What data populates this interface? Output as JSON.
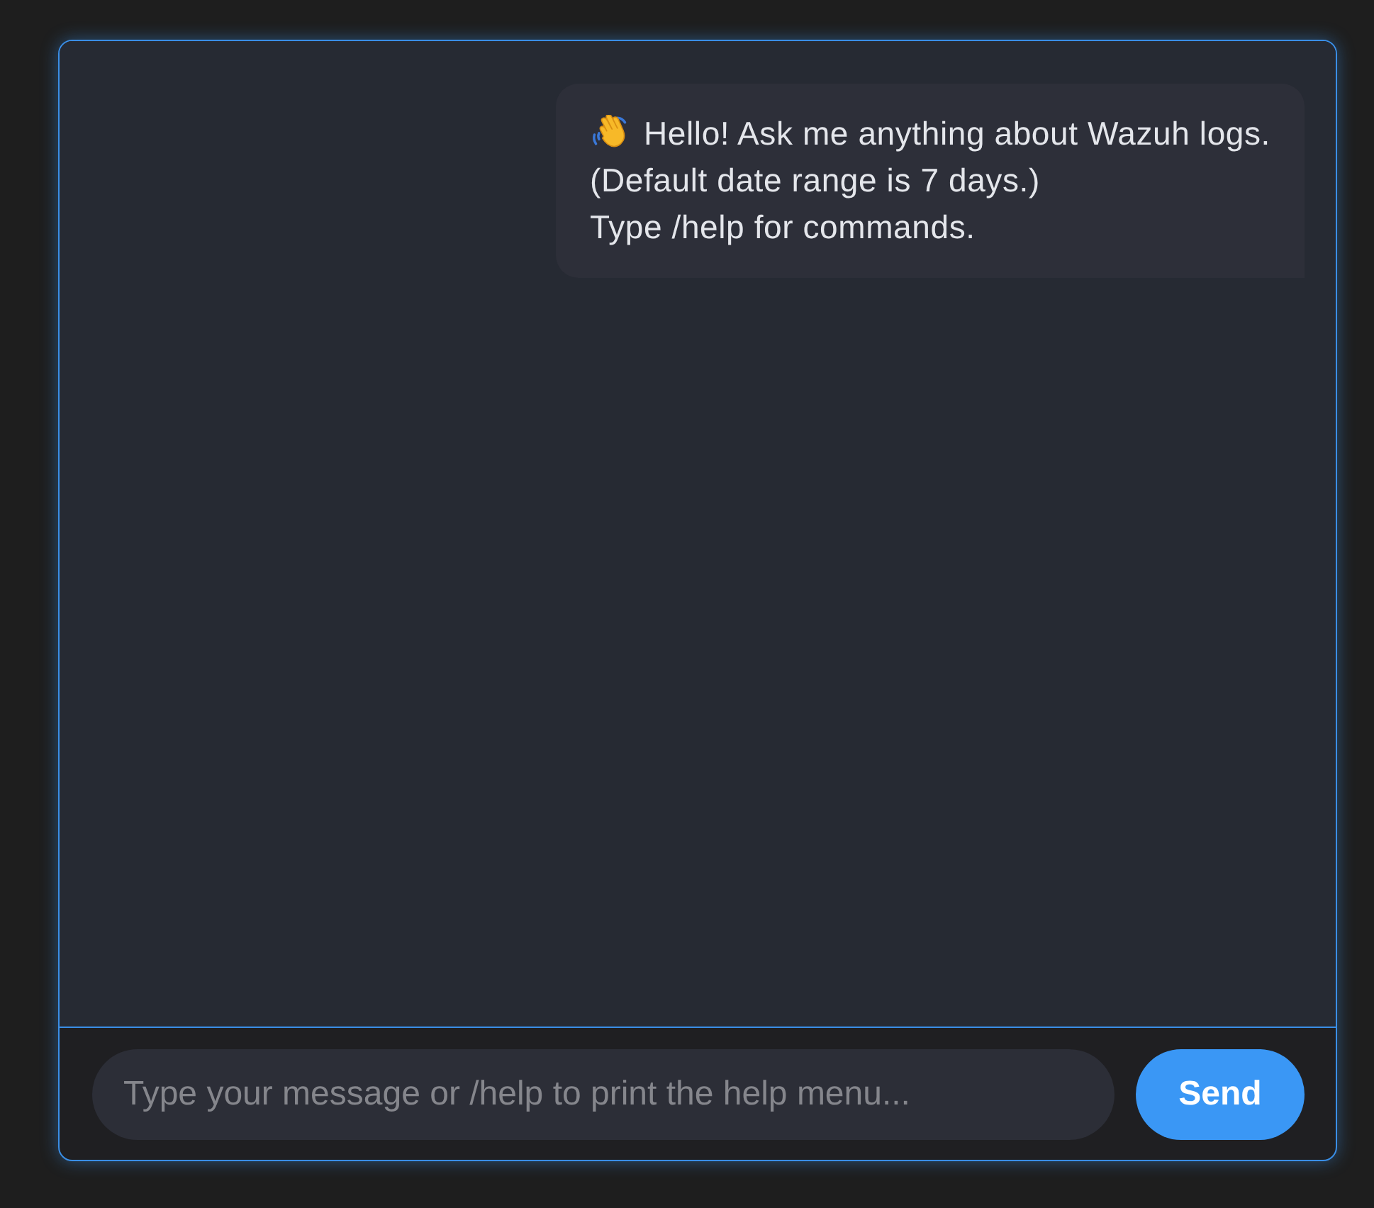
{
  "messages": [
    {
      "lines": [
        "Hello! Ask me anything about Wazuh logs.",
        "(Default date range is 7 days.)",
        "Type /help for commands."
      ]
    }
  ],
  "composer": {
    "placeholder": "Type your message or /help to print the help menu...",
    "send_label": "Send"
  }
}
